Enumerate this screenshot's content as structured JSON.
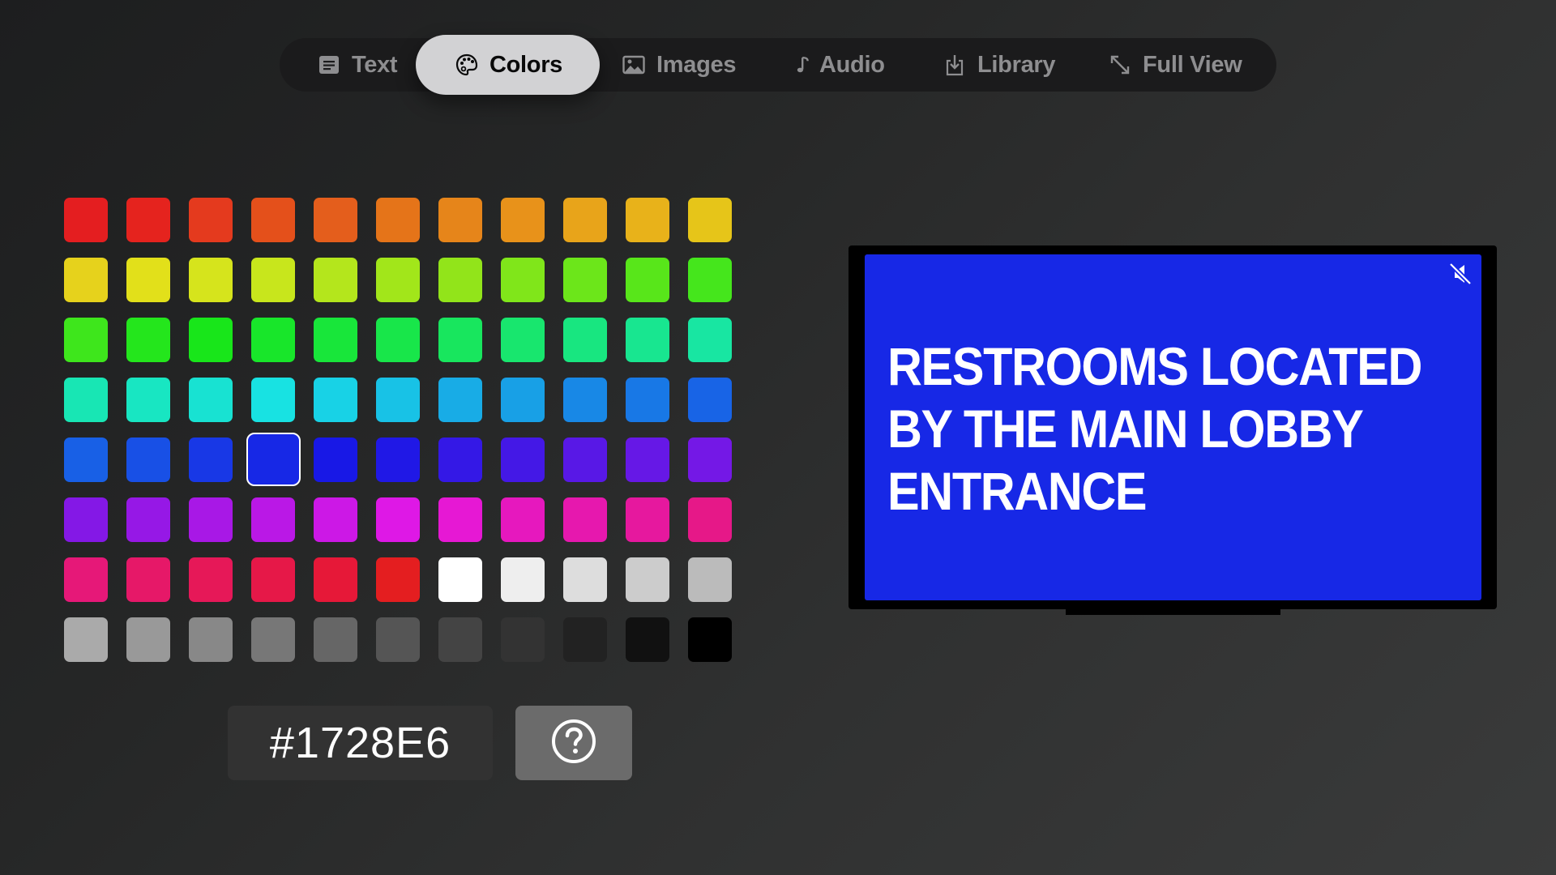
{
  "tabs": [
    {
      "label": "Text",
      "icon": "text-doc-icon",
      "active": false
    },
    {
      "label": "Colors",
      "icon": "palette-icon",
      "active": true
    },
    {
      "label": "Images",
      "icon": "photo-icon",
      "active": false
    },
    {
      "label": "Audio",
      "icon": "music-note-icon",
      "active": false
    },
    {
      "label": "Library",
      "icon": "import-icon",
      "active": false
    },
    {
      "label": "Full View",
      "icon": "expand-arrows-icon",
      "active": false
    }
  ],
  "palette": {
    "columns": 11,
    "selected_index": 47,
    "colors": [
      "#E41E20",
      "#E5231E",
      "#E43A1E",
      "#E4501B",
      "#E45E1C",
      "#E57419",
      "#E6851A",
      "#E8921A",
      "#E8A41A",
      "#E8B21A",
      "#E6C519",
      "#E6D21C",
      "#E2E01A",
      "#D6E41C",
      "#C8E61C",
      "#B4E61C",
      "#A2E61A",
      "#92E41A",
      "#80E61A",
      "#6CE61A",
      "#58E61A",
      "#45E61C",
      "#3EE61C",
      "#24E61C",
      "#18E61A",
      "#18E62A",
      "#18E63A",
      "#18E64A",
      "#18E65E",
      "#18E66E",
      "#18E680",
      "#18E690",
      "#18E6A2",
      "#18E6B4",
      "#18E6C2",
      "#18E2D2",
      "#18E2E2",
      "#18D2E6",
      "#18C2E6",
      "#18ACE6",
      "#18A0E6",
      "#1888E6",
      "#1878E6",
      "#1864E6",
      "#1860E6",
      "#1850E6",
      "#1838E6",
      "#1728E6",
      "#1818E6",
      "#2018E6",
      "#3418E6",
      "#4418E6",
      "#5818E6",
      "#6618E6",
      "#7418E6",
      "#8418E6",
      "#9618E6",
      "#A818E6",
      "#BA18E6",
      "#CC18E6",
      "#DE18E6",
      "#E618D4",
      "#E618BE",
      "#E618AE",
      "#E6189E",
      "#E61888",
      "#E61878",
      "#E61868",
      "#E61858",
      "#E61848",
      "#E61838",
      "#E41E20",
      "#FFFFFF",
      "#EEEEEE",
      "#DDDDDD",
      "#CCCCCC",
      "#BBBBBB",
      "#AAAAAA",
      "#999999",
      "#888888",
      "#777777",
      "#666666",
      "#555555",
      "#444444",
      "#333333",
      "#222222",
      "#111111",
      "#000000"
    ]
  },
  "hex_input": {
    "value": "#1728E6"
  },
  "help_button": {
    "icon": "question-circle-icon"
  },
  "preview": {
    "background": "#1728E6",
    "text_lines": [
      "RESTROOMS LOCATED",
      "BY THE MAIN LOBBY",
      "ENTRANCE"
    ],
    "mute_icon": "speaker-muted-icon"
  }
}
